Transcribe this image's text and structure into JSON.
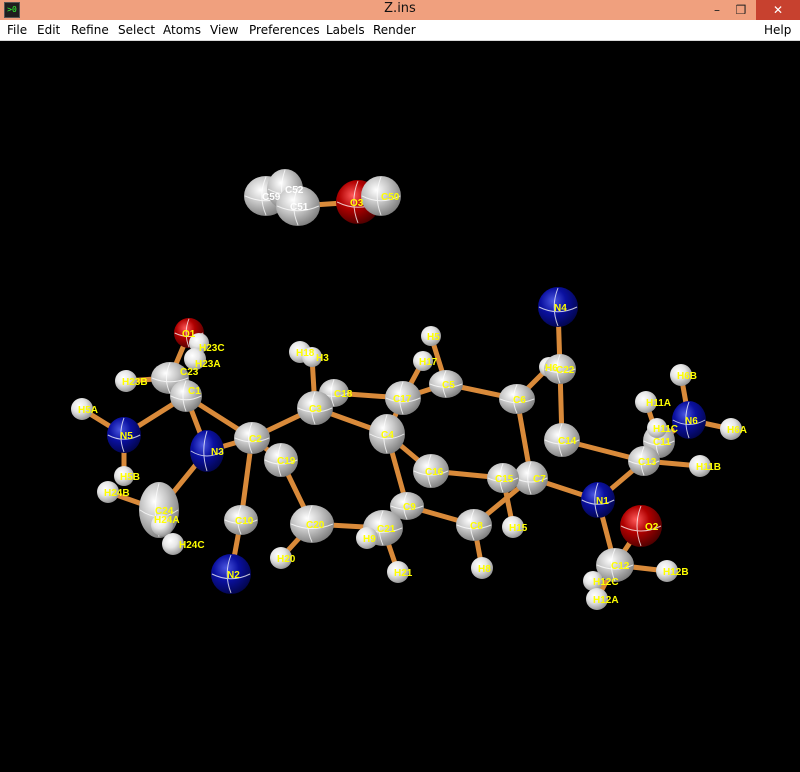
{
  "window": {
    "title": "Z.ins",
    "icon": "app-icon",
    "controls": {
      "minimize": "–",
      "maximize": "❒",
      "close": "✕"
    }
  },
  "menu": {
    "file": "File",
    "edit": "Edit",
    "refine": "Refine",
    "select": "Select",
    "atoms": "Atoms",
    "view": "View",
    "preferences": "Preferences",
    "labels": "Labels",
    "render": "Render",
    "help": "Help"
  },
  "colors": {
    "carbon": "#c8c8c8",
    "hydrogen": "#ffffff",
    "nitrogen": "#0a10a0",
    "oxygen": "#b00000",
    "bond": "#d98a3a",
    "label": "#ffff00",
    "background": "#000000"
  },
  "atoms": [
    {
      "id": "C59",
      "el": "C",
      "label": "C59",
      "labelColor": "w"
    },
    {
      "id": "C52",
      "el": "C",
      "label": "C52",
      "labelColor": "w"
    },
    {
      "id": "C51",
      "el": "C",
      "label": "C51",
      "labelColor": "w"
    },
    {
      "id": "O3",
      "el": "O",
      "label": "O3"
    },
    {
      "id": "C50",
      "el": "C",
      "label": "C50"
    },
    {
      "id": "N4",
      "el": "N",
      "label": "N4"
    },
    {
      "id": "O1",
      "el": "O",
      "label": "O1"
    },
    {
      "id": "H23C",
      "el": "H",
      "label": "H23C"
    },
    {
      "id": "H23A",
      "el": "H",
      "label": "H23A"
    },
    {
      "id": "H23B",
      "el": "H",
      "label": "H23B"
    },
    {
      "id": "C23",
      "el": "C",
      "label": "C23"
    },
    {
      "id": "C1",
      "el": "C",
      "label": "C1"
    },
    {
      "id": "H5A",
      "el": "H",
      "label": "H5A"
    },
    {
      "id": "N5",
      "el": "N",
      "label": "N5"
    },
    {
      "id": "N3",
      "el": "N",
      "label": "N3"
    },
    {
      "id": "C2",
      "el": "C",
      "label": "C2"
    },
    {
      "id": "H18",
      "el": "H",
      "label": "H18"
    },
    {
      "id": "H3",
      "el": "H",
      "label": "H3"
    },
    {
      "id": "C18",
      "el": "C",
      "label": "C18"
    },
    {
      "id": "C3",
      "el": "C",
      "label": "C3"
    },
    {
      "id": "C19",
      "el": "C",
      "label": "C19"
    },
    {
      "id": "H5",
      "el": "H",
      "label": "H5"
    },
    {
      "id": "H17",
      "el": "H",
      "label": "H17"
    },
    {
      "id": "C5",
      "el": "C",
      "label": "C5"
    },
    {
      "id": "C17",
      "el": "C",
      "label": "C17"
    },
    {
      "id": "C4",
      "el": "C",
      "label": "C4"
    },
    {
      "id": "H6",
      "el": "H",
      "label": "H6"
    },
    {
      "id": "C22",
      "el": "C",
      "label": "C22"
    },
    {
      "id": "C6",
      "el": "C",
      "label": "C6"
    },
    {
      "id": "C14",
      "el": "C",
      "label": "C14"
    },
    {
      "id": "H6B",
      "el": "H",
      "label": "H6B"
    },
    {
      "id": "H11A",
      "el": "H",
      "label": "H11A"
    },
    {
      "id": "N6",
      "el": "N",
      "label": "N6"
    },
    {
      "id": "H6A",
      "el": "H",
      "label": "H6A"
    },
    {
      "id": "C11",
      "el": "C",
      "label": "C11"
    },
    {
      "id": "H11C",
      "el": "H",
      "label": "H11C"
    },
    {
      "id": "C13",
      "el": "C",
      "label": "C13"
    },
    {
      "id": "H11B",
      "el": "H",
      "label": "H11B"
    },
    {
      "id": "C16",
      "el": "C",
      "label": "C16"
    },
    {
      "id": "C7",
      "el": "C",
      "label": "C7"
    },
    {
      "id": "C15",
      "el": "C",
      "label": "C15"
    },
    {
      "id": "N1",
      "el": "N",
      "label": "N1"
    },
    {
      "id": "O2",
      "el": "O",
      "label": "O2"
    },
    {
      "id": "H5B",
      "el": "H",
      "label": "H5B"
    },
    {
      "id": "H24B",
      "el": "H",
      "label": "H24B"
    },
    {
      "id": "C24",
      "el": "C",
      "label": "C24"
    },
    {
      "id": "H24A",
      "el": "H",
      "label": "H24A"
    },
    {
      "id": "H24C",
      "el": "H",
      "label": "H24C"
    },
    {
      "id": "C10",
      "el": "C",
      "label": "C10"
    },
    {
      "id": "C20",
      "el": "C",
      "label": "C20"
    },
    {
      "id": "C9",
      "el": "C",
      "label": "C9"
    },
    {
      "id": "C21",
      "el": "C",
      "label": "C21"
    },
    {
      "id": "H9",
      "el": "H",
      "label": "H9"
    },
    {
      "id": "C8",
      "el": "C",
      "label": "C8"
    },
    {
      "id": "H15",
      "el": "H",
      "label": "H15"
    },
    {
      "id": "N2",
      "el": "N",
      "label": "N2"
    },
    {
      "id": "H20",
      "el": "H",
      "label": "H20"
    },
    {
      "id": "H21",
      "el": "H",
      "label": "H21"
    },
    {
      "id": "H8",
      "el": "H",
      "label": "H8"
    },
    {
      "id": "C12",
      "el": "C",
      "label": "C12"
    },
    {
      "id": "H12C",
      "el": "H",
      "label": "H12C"
    },
    {
      "id": "H12B",
      "el": "H",
      "label": "H12B"
    },
    {
      "id": "H12A",
      "el": "H",
      "label": "H12A"
    }
  ],
  "bonds": [
    [
      "C51",
      "O3"
    ],
    [
      "O1",
      "C23"
    ],
    [
      "C23",
      "C1"
    ],
    [
      "H23B",
      "C23"
    ],
    [
      "C1",
      "N5"
    ],
    [
      "C1",
      "N3"
    ],
    [
      "N5",
      "H5A"
    ],
    [
      "N5",
      "H5B"
    ],
    [
      "C1",
      "C2"
    ],
    [
      "N3",
      "C24"
    ],
    [
      "C24",
      "H24B"
    ],
    [
      "C24",
      "H24A"
    ],
    [
      "N3",
      "C2"
    ],
    [
      "C2",
      "C3"
    ],
    [
      "C2",
      "C10"
    ],
    [
      "C2",
      "C19"
    ],
    [
      "C10",
      "N2"
    ],
    [
      "C19",
      "C20"
    ],
    [
      "C3",
      "H3"
    ],
    [
      "C3",
      "C18"
    ],
    [
      "C18",
      "C17"
    ],
    [
      "C17",
      "C4"
    ],
    [
      "C17",
      "C5"
    ],
    [
      "C17",
      "H17"
    ],
    [
      "C5",
      "H5"
    ],
    [
      "C5",
      "C6"
    ],
    [
      "C6",
      "H6"
    ],
    [
      "C6",
      "C7"
    ],
    [
      "C22",
      "N4"
    ],
    [
      "C22",
      "C14"
    ],
    [
      "C14",
      "C13"
    ],
    [
      "C4",
      "C16"
    ],
    [
      "C4",
      "C9"
    ],
    [
      "C16",
      "C15"
    ],
    [
      "C15",
      "C7"
    ],
    [
      "C7",
      "N1"
    ],
    [
      "C9",
      "C21"
    ],
    [
      "C9",
      "C8"
    ],
    [
      "C21",
      "C20"
    ],
    [
      "C21",
      "H9"
    ],
    [
      "C21",
      "H21"
    ],
    [
      "C8",
      "H8"
    ],
    [
      "C8",
      "C7"
    ],
    [
      "C15",
      "H15"
    ],
    [
      "N1",
      "C13"
    ],
    [
      "N1",
      "C12"
    ],
    [
      "C13",
      "C11"
    ],
    [
      "C13",
      "H11B"
    ],
    [
      "C11",
      "N6"
    ],
    [
      "C11",
      "H11A"
    ],
    [
      "N6",
      "H6B"
    ],
    [
      "N6",
      "H6A"
    ],
    [
      "C12",
      "O2"
    ],
    [
      "C12",
      "H12C"
    ],
    [
      "C12",
      "H12B"
    ],
    [
      "C12",
      "H12A"
    ],
    [
      "C20",
      "H20"
    ],
    [
      "C3",
      "C4"
    ]
  ]
}
